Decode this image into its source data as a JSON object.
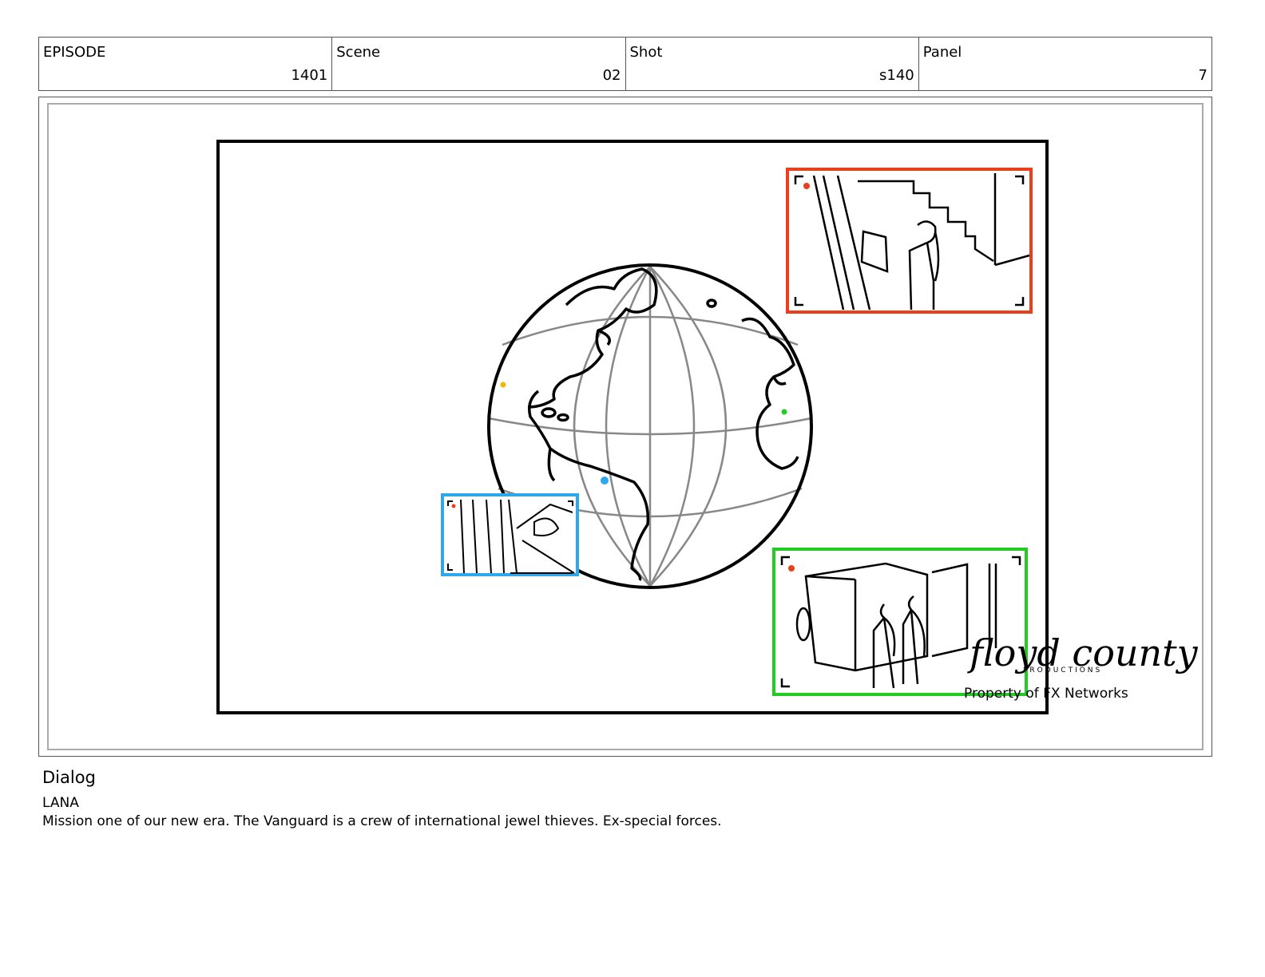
{
  "header": {
    "episode_label": "EPISODE",
    "episode_value": "1401",
    "scene_label": "Scene",
    "scene_value": "02",
    "shot_label": "Shot",
    "shot_value": "s140",
    "panel_label": "Panel",
    "panel_value": "7"
  },
  "panel": {
    "watermark_logo": "floyd county",
    "watermark_sub": "PRODUCTIONS",
    "watermark_property": "Property of FX Networks",
    "inset_colors": {
      "stairs": "#e8401c",
      "street": "#2ea8ec",
      "truck": "#22cc22"
    }
  },
  "dialog": {
    "title": "Dialog",
    "speaker": "LANA",
    "line": "Mission one of our new era. The Vanguard is a crew of international jewel thieves. Ex-special forces."
  }
}
